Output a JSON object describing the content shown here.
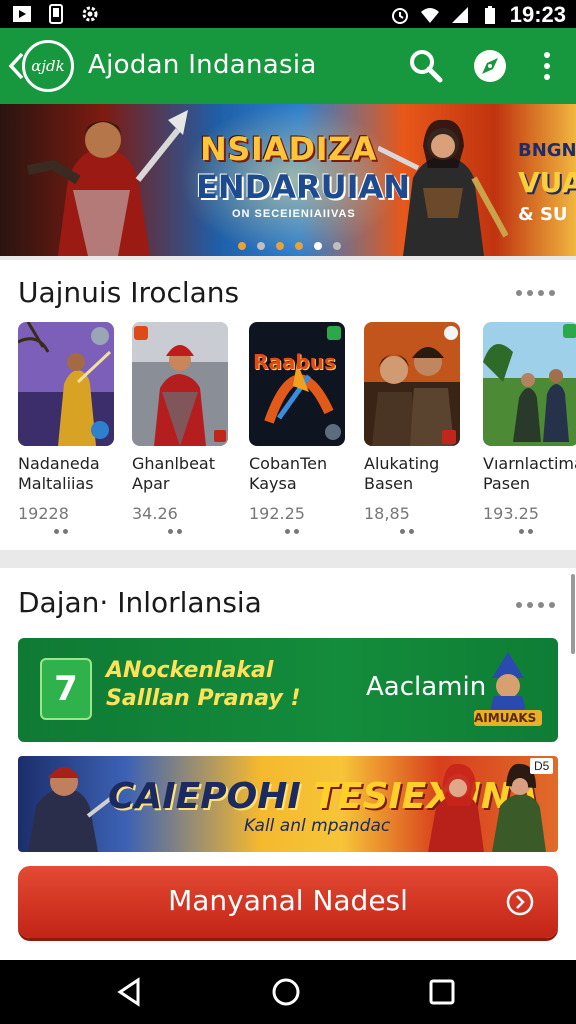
{
  "status_bar": {
    "time": "19:23",
    "left_icons": [
      "play-store-icon",
      "phone-icon",
      "gear-icon"
    ],
    "right_icons": [
      "alarm-icon",
      "wifi-icon",
      "signal-icon",
      "battery-icon"
    ]
  },
  "app_bar": {
    "logo_text": "ɑjdk",
    "title": "Ajodan  Indanasia",
    "actions": [
      "search-icon",
      "compass-icon",
      "more-vert-icon"
    ]
  },
  "banner": {
    "title": "NSIADIZA",
    "subtitle": "ENDARUIAN",
    "tagline": "ON SECEIENIAIIVAS",
    "side_title": "BNGNE",
    "side_sub": "VUAN",
    "side_small": "& SU",
    "carousel_dots": [
      "#e8a23a",
      "#bfbfbf",
      "#e8a23a",
      "#e8a23a",
      "#ffffff",
      "#bfbfbf"
    ]
  },
  "section1": {
    "title": "Uajnuis Iroclans",
    "apps": [
      {
        "name_line1": "Nadaneda",
        "name_line2": "Maltaliias",
        "size": "19228"
      },
      {
        "name_line1": "Ghanlbeat",
        "name_line2": "Apar",
        "size": "34.26"
      },
      {
        "name_line1": "CobanTen",
        "name_line2": "Kaysa",
        "size": "192.25"
      },
      {
        "name_line1": "Alukating",
        "name_line2": "Basen",
        "size": "18,85"
      },
      {
        "name_line1": "Vıarnlactima",
        "name_line2": "Pasen",
        "size": "193.25"
      }
    ],
    "thumb_labels": [
      "",
      "",
      "Raabus",
      "",
      ""
    ]
  },
  "section2": {
    "title": "Dajan· Inlorlansia",
    "promo1": {
      "icon_glyph": "7",
      "line1": "ANockenlakal",
      "line2": "Salllan Pranay !",
      "action": "Aaclamin",
      "badge": "AIMUAKS"
    },
    "promo2": {
      "title_a": "CAIEPOHI",
      "title_b": "TESIEXIINA",
      "sub": "Kall anl mpandac",
      "corner": "D5"
    },
    "cta_label": "Manyanal Nadesl"
  },
  "nav_bar": {
    "buttons": [
      "back-triangle-icon",
      "home-circle-icon",
      "recents-square-icon"
    ]
  },
  "colors": {
    "app_bar": "#17983e",
    "cta": "#d33322",
    "promo_green": "#138c3b"
  }
}
